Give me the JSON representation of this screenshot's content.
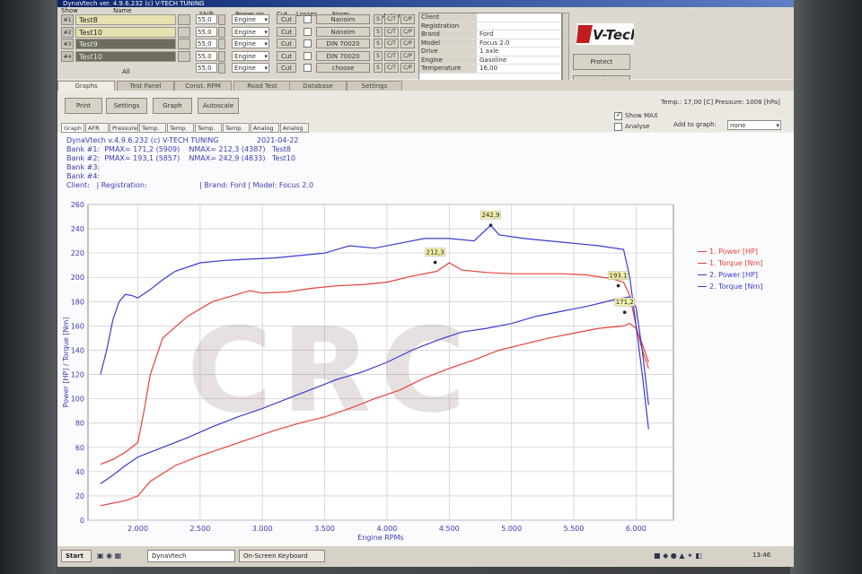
{
  "window": {
    "title": "DynaVtech ver. 4.9.6.232 (c) V-TECH TUNING"
  },
  "controls": {
    "headers": {
      "show": "Show",
      "name": "Name",
      "shift": "Shift",
      "power_on": "Power on",
      "cut": "Cut",
      "losses": "Losses",
      "norm": "Norm",
      "action": "Action",
      "all": "All"
    },
    "banks": [
      {
        "num": "#1",
        "name": "Test8",
        "shift": "55,0",
        "power_on": "Engine",
        "cut": "Cut",
        "norm": "Nanoim",
        "a1": "S",
        "a2": "C/T",
        "a3": "C/P"
      },
      {
        "num": "#2",
        "name": "Test10",
        "shift": "55,0",
        "power_on": "Engine",
        "cut": "Cut",
        "norm": "Nanoim",
        "a1": "S",
        "a2": "C/T",
        "a3": "C/P"
      },
      {
        "num": "#3",
        "name": "Test9",
        "shift": "55,0",
        "power_on": "Engine",
        "cut": "Cut",
        "norm": "DIN 70020",
        "a1": "S",
        "a2": "C/T",
        "a3": "C/P"
      },
      {
        "num": "#4",
        "name": "Test10",
        "shift": "55,0",
        "power_on": "Engine",
        "cut": "Cut",
        "norm": "DIN 70020",
        "a1": "S",
        "a2": "C/T",
        "a3": "C/P"
      },
      {
        "num": "",
        "name": "",
        "shift": "55,0",
        "power_on": "Engine",
        "cut": "Cut",
        "norm": "choose",
        "a1": "S",
        "a2": "C/T",
        "a3": "C/P"
      }
    ],
    "info": [
      {
        "k": "Client",
        "v": ""
      },
      {
        "k": "Registration",
        "v": ""
      },
      {
        "k": "Brand",
        "v": "Ford"
      },
      {
        "k": "Model",
        "v": "Focus 2.0"
      },
      {
        "k": "Drive",
        "v": "1 axle"
      },
      {
        "k": "Engine",
        "v": "Gasoline"
      },
      {
        "k": "Temperature",
        "v": "16,00"
      }
    ],
    "logo_text": "V-Tech",
    "protect_label": "Protect",
    "exit_label": "Exit"
  },
  "tabs": [
    "Graphs",
    "Test Panel",
    "Const. RPM",
    "Road Test",
    "Database",
    "Settings"
  ],
  "toolbar": {
    "print": "Print",
    "settings": "Settings",
    "graph": "Graph",
    "autoscale": "Autoscale",
    "temp_pressure": "Temp.: 17,00 [C]   Pressure: 1008 [hPa]",
    "show_max": "Show MAX",
    "analyse": "Analyse",
    "add_to_graph": "Add to graph:",
    "add_value": "none"
  },
  "subtabs": [
    "Graph",
    "AFR",
    "Pressure",
    "Temp. A",
    "Temp. B",
    "Temp. C",
    "Temp. D",
    "Analog 1",
    "Analog 2"
  ],
  "graph_header": {
    "line1": "DynaVtech v.4.9.6.232 (c) V-TECH TUNING",
    "date": "2021-04-22",
    "line2": "Bank #1:  PMAX= 171,2 (5909)    NMAX= 212,3 (4387)   Test8",
    "line3": "Bank #2:  PMAX= 193,1 (5857)    NMAX= 242,9 (4833)   Test10",
    "line4": "Bank #3:",
    "line5": "Bank #4:",
    "line6": "Client:   | Registration:                       | Brand: Ford | Model: Focus 2.0"
  },
  "watermark": "CRC",
  "chart_data": {
    "type": "line",
    "xlabel": "Engine RPMs",
    "ylabel": "Power [HP] / Torque [Nm]",
    "xlim": [
      1600,
      6300
    ],
    "ylim": [
      0,
      260
    ],
    "x_ticks": [
      "2.000",
      "2.500",
      "3.000",
      "3.500",
      "4.000",
      "4.500",
      "5.000",
      "5.500",
      "6.000"
    ],
    "x_tick_values": [
      2000,
      2500,
      3000,
      3500,
      4000,
      4500,
      5000,
      5500,
      6000
    ],
    "y_ticks": [
      0,
      20,
      40,
      60,
      80,
      100,
      120,
      140,
      160,
      180,
      200,
      220,
      240,
      260
    ],
    "grid": true,
    "legend_position": "right",
    "series": [
      {
        "name": "1. Power [HP]",
        "color": "#e8413a",
        "x": [
          1700,
          1800,
          1900,
          2000,
          2100,
          2300,
          2500,
          2700,
          2900,
          3100,
          3300,
          3500,
          3700,
          3900,
          4100,
          4300,
          4500,
          4700,
          4900,
          5100,
          5300,
          5500,
          5700,
          5900,
          5950,
          6000,
          6050,
          6100
        ],
        "y": [
          12,
          14,
          16,
          20,
          32,
          45,
          53,
          60,
          67,
          74,
          80,
          85,
          92,
          100,
          107,
          117,
          125,
          132,
          140,
          145,
          150,
          154,
          158,
          160,
          162,
          158,
          145,
          130
        ]
      },
      {
        "name": "1. Torque [Nm]",
        "color": "#e8413a",
        "x": [
          1700,
          1800,
          1900,
          2000,
          2050,
          2100,
          2200,
          2400,
          2600,
          2800,
          2900,
          3000,
          3200,
          3400,
          3600,
          3800,
          4000,
          4200,
          4400,
          4500,
          4600,
          4800,
          5000,
          5200,
          5400,
          5600,
          5800,
          5900,
          5950,
          6000,
          6050,
          6100
        ],
        "y": [
          46,
          50,
          56,
          64,
          90,
          120,
          150,
          168,
          180,
          186,
          189,
          187,
          188,
          191,
          193,
          194,
          196,
          201,
          205,
          212,
          206,
          204,
          203,
          203,
          203,
          202,
          199,
          196,
          185,
          160,
          140,
          125
        ]
      },
      {
        "name": "2. Power [HP]",
        "color": "#3a3ad0",
        "x": [
          1700,
          1800,
          1900,
          2000,
          2200,
          2400,
          2600,
          2800,
          3000,
          3200,
          3400,
          3600,
          3800,
          4000,
          4200,
          4400,
          4600,
          4800,
          5000,
          5200,
          5400,
          5600,
          5800,
          5900,
          5950,
          6000,
          6050,
          6100
        ],
        "y": [
          30,
          37,
          45,
          52,
          60,
          68,
          77,
          85,
          92,
          100,
          108,
          116,
          122,
          130,
          140,
          148,
          155,
          158,
          162,
          168,
          172,
          176,
          181,
          183,
          184,
          175,
          140,
          95
        ]
      },
      {
        "name": "2. Torque [Nm]",
        "color": "#3a3ad0",
        "x": [
          1700,
          1750,
          1800,
          1850,
          1900,
          1950,
          2000,
          2100,
          2200,
          2300,
          2500,
          2700,
          2900,
          3100,
          3300,
          3500,
          3700,
          3900,
          4100,
          4300,
          4500,
          4700,
          4833,
          4900,
          5100,
          5300,
          5500,
          5700,
          5900,
          5950,
          6000,
          6050,
          6100
        ],
        "y": [
          120,
          140,
          165,
          180,
          186,
          185,
          183,
          190,
          198,
          205,
          212,
          214,
          215,
          216,
          218,
          220,
          226,
          224,
          228,
          232,
          232,
          230,
          242.9,
          235,
          232,
          230,
          228,
          226,
          223,
          200,
          160,
          120,
          75
        ]
      }
    ],
    "annotations": [
      {
        "x": 4833,
        "y": 242.9,
        "label": "242,9"
      },
      {
        "x": 4387,
        "y": 212.3,
        "label": "212,3"
      },
      {
        "x": 5857,
        "y": 193.1,
        "label": "193,1"
      },
      {
        "x": 5909,
        "y": 171.2,
        "label": "171,2"
      }
    ]
  },
  "taskbar": {
    "start": "Start",
    "app1": "DynaVtech",
    "app2": "On-Screen Keyboard",
    "clock": "13:46"
  }
}
